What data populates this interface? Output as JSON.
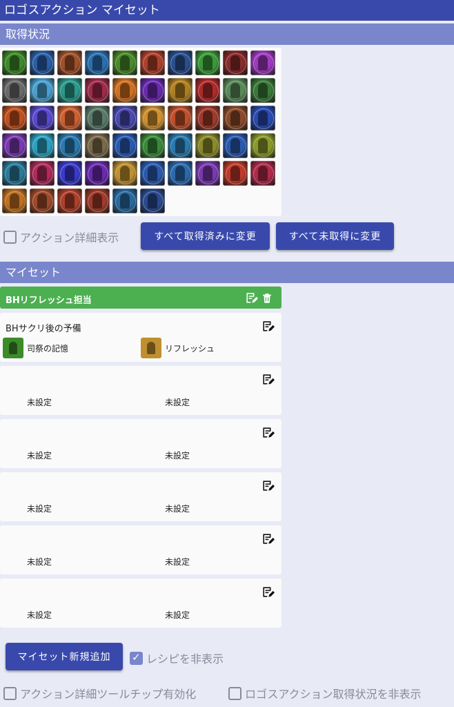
{
  "app": {
    "title": "ロゴスアクション マイセット"
  },
  "sections": {
    "status": "取得状況",
    "myset": "マイセット"
  },
  "icon_colors": [
    "#3d8a2a",
    "#2a5fa8",
    "#a0502a",
    "#2a6fb0",
    "#4a8a2a",
    "#b0402a",
    "#2a5090",
    "#3a9a3a",
    "#8a2a2a",
    "#a03ac0",
    "#6a6a6a",
    "#4aa0d0",
    "#2a9a8a",
    "#a02a4a",
    "#d07020",
    "#6a2ab0",
    "#b08020",
    "#b02a2a",
    "#5a8a5a",
    "#3a7a3a",
    "#c05020",
    "#5a4ad0",
    "#d06030",
    "#5a7a6a",
    "#4a4ab0",
    "#d09030",
    "#c0502a",
    "#a03a2a",
    "#8a4a2a",
    "#2a4ab0",
    "#7a3ab0",
    "#2aa0c0",
    "#2a7ab0",
    "#7a6a4a",
    "#2a5ab0",
    "#3a8a3a",
    "#2a7ab0",
    "#8a8a2a",
    "#2a5ab0",
    "#8a9a2a",
    "#2a7a9a",
    "#b02a5a",
    "#3a3ad0",
    "#6a2ab0",
    "#c09030",
    "#2a5ab0",
    "#2a6ab0",
    "#7a3ab0",
    "#c03a2a",
    "#b02a4a",
    "#c07020",
    "#a04a2a",
    "#b0402a",
    "#a03a2a",
    "#2a6aa0",
    "#2a4a90"
  ],
  "status_controls": {
    "detail_label": "アクション詳細表示",
    "all_acquired_button": "すべて取得済みに変更",
    "all_unacquired_button": "すべて未取得に変更"
  },
  "mysets": [
    {
      "name": "BHリフレッシュ担当",
      "active": true
    },
    {
      "name": "BHサクリ後の予備",
      "active": false,
      "slots": [
        {
          "label": "司祭の記憶",
          "color": "#3d8a2a"
        },
        {
          "label": "リフレッシュ",
          "color": "#c09030"
        }
      ]
    },
    {
      "name": "",
      "active": false,
      "slots": [
        {
          "label": "未設定"
        },
        {
          "label": "未設定"
        }
      ]
    },
    {
      "name": "",
      "active": false,
      "slots": [
        {
          "label": "未設定"
        },
        {
          "label": "未設定"
        }
      ]
    },
    {
      "name": "",
      "active": false,
      "slots": [
        {
          "label": "未設定"
        },
        {
          "label": "未設定"
        }
      ]
    },
    {
      "name": "",
      "active": false,
      "slots": [
        {
          "label": "未設定"
        },
        {
          "label": "未設定"
        }
      ]
    },
    {
      "name": "",
      "active": false,
      "slots": [
        {
          "label": "未設定"
        },
        {
          "label": "未設定"
        }
      ]
    }
  ],
  "footer": {
    "add_button": "マイセット新規追加",
    "hide_recipe": {
      "label": "レシピを非表示",
      "checked": true
    },
    "tooltip": {
      "label": "アクション詳細ツールチップ有効化",
      "checked": false
    },
    "hide_status": {
      "label": "ロゴスアクション取得状況を非表示",
      "checked": false
    }
  },
  "icons": {
    "edit": "edit-note-icon",
    "delete": "trash-icon",
    "checkbox": "checkbox-icon"
  }
}
